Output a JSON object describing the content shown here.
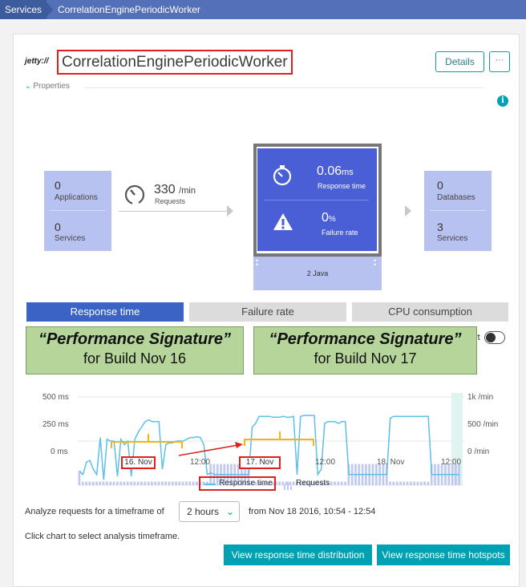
{
  "breadcrumb": {
    "root": "Services",
    "current": "CorrelationEnginePeriodicWorker"
  },
  "header": {
    "logo_text": "jetty://",
    "title": "CorrelationEnginePeriodicWorker",
    "details_label": "Details",
    "more_label": "···"
  },
  "properties_label": "Properties",
  "info_icon": "i",
  "flow": {
    "left": {
      "apps_count": "0",
      "apps_label": "Applications",
      "services_count": "0",
      "services_label": "Services"
    },
    "requests": {
      "value": "330",
      "unit": "/min",
      "label": "Requests"
    },
    "center": {
      "rt_value": "0.06",
      "rt_unit": "ms",
      "rt_label": "Response time",
      "fr_value": "0",
      "fr_unit": "%",
      "fr_label": "Failure rate",
      "tech_label": "2 Java"
    },
    "right": {
      "db_count": "0",
      "db_label": "Databases",
      "services_count": "3",
      "services_label": "Services"
    }
  },
  "tabs": [
    "Response time",
    "Failure rate",
    "CPU consumption"
  ],
  "callouts": [
    {
      "line1": "“Performance Signature”",
      "line2": "for Build Nov 16"
    },
    {
      "line1": "“Performance Signature”",
      "line2": "for Build Nov 17"
    }
  ],
  "toggle_suffix": "rt",
  "chart_data": {
    "type": "line",
    "y_left_ticks": [
      "500 ms",
      "250 ms",
      "0 ms"
    ],
    "y_right_ticks": [
      "1k /min",
      "500 /min",
      "0 /min"
    ],
    "x_ticks": [
      "16. Nov",
      "12:00",
      "17. Nov",
      "12:00",
      "18. Nov",
      "12:00"
    ],
    "series": [
      {
        "name": "Response time",
        "color": "#5bc0ea",
        "values": [
          80,
          60,
          130,
          140,
          90,
          60,
          270,
          30,
          260,
          250,
          250,
          50,
          260,
          230,
          250,
          50,
          260,
          300,
          330,
          360,
          370,
          360,
          360,
          360,
          90,
          230,
          240,
          240,
          250,
          250,
          250,
          260,
          270,
          270,
          275,
          270,
          230,
          60,
          70,
          60,
          60,
          60,
          60,
          60,
          60,
          60,
          60,
          60,
          60,
          60,
          330,
          350,
          390,
          390,
          390,
          390,
          385,
          385,
          385,
          390,
          385,
          385,
          390,
          60,
          390,
          395,
          395,
          395,
          395,
          60,
          90,
          350,
          360,
          360,
          360,
          350,
          360,
          360,
          60,
          60,
          60,
          60,
          60,
          60,
          60,
          60,
          60,
          60,
          60,
          60,
          380,
          390,
          390,
          390,
          390,
          390,
          390,
          390,
          390,
          390,
          390,
          390,
          60,
          60,
          60,
          60,
          60,
          60,
          60,
          60,
          60
        ]
      },
      {
        "name": "Requests",
        "color": "#c1c8f1",
        "values": [
          160,
          40,
          40,
          40,
          40,
          40,
          40,
          40,
          40,
          40,
          40,
          40,
          40,
          40,
          40,
          40,
          40,
          40,
          40,
          40,
          40,
          40,
          40,
          40,
          40,
          40,
          40,
          40,
          40,
          40,
          40,
          40,
          40,
          40,
          40,
          40,
          40,
          40,
          240,
          240,
          240,
          240,
          240,
          240,
          240,
          240,
          240,
          240,
          240,
          240,
          40,
          40,
          40,
          40,
          40,
          40,
          40,
          40,
          40,
          40,
          40,
          40,
          40,
          40,
          40,
          40,
          40,
          40,
          40,
          40,
          40,
          40,
          40,
          40,
          40,
          40,
          40,
          40,
          240,
          240,
          240,
          240,
          240,
          240,
          240,
          240,
          240,
          240,
          240,
          240,
          40,
          40,
          40,
          40,
          40,
          40,
          40,
          40,
          40,
          40,
          40,
          40,
          240,
          240,
          240,
          240,
          240,
          240,
          240,
          240,
          240
        ]
      }
    ],
    "y_max_ms": 500,
    "y_max_req": 1000,
    "legend": [
      "Response time",
      "Requests"
    ]
  },
  "analyze": {
    "prefix": "Analyze requests for a timeframe of",
    "timeframe": "2 hours",
    "range": "from Nov 18 2016, 10:54 - 12:54",
    "hint": "Click chart to select analysis timeframe."
  },
  "buttons": {
    "distribution": "View response time distribution",
    "hotspots": "View response time hotspots"
  }
}
